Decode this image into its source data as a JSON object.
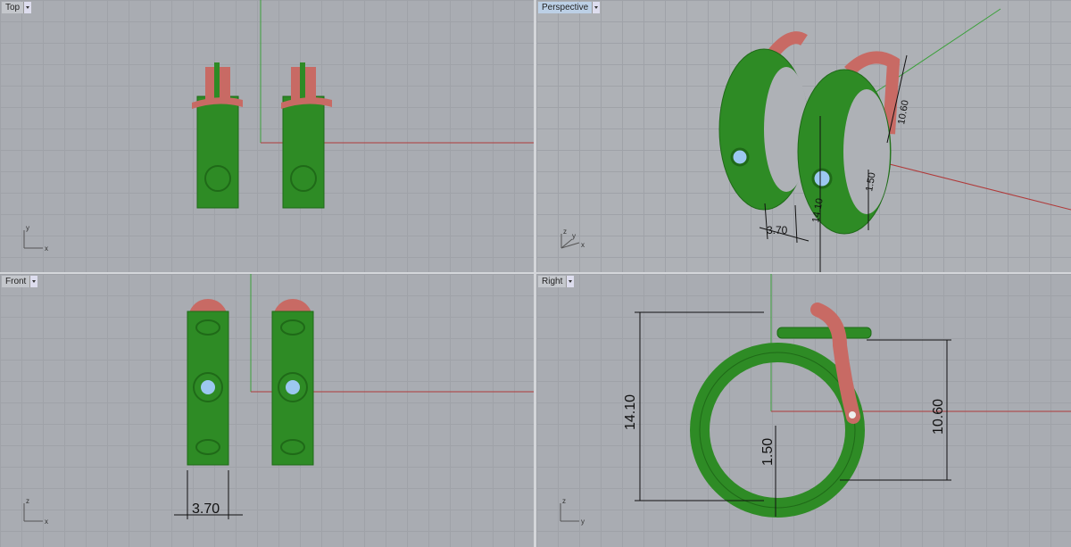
{
  "viewports": [
    {
      "label": "Top",
      "active": false,
      "axes": [
        "x",
        "y"
      ]
    },
    {
      "label": "Perspective",
      "active": true,
      "axes": [
        "x",
        "y",
        "z"
      ],
      "dimensions": [
        "3.70",
        "14.10",
        "10.60",
        "1.50"
      ]
    },
    {
      "label": "Front",
      "active": false,
      "axes": [
        "x",
        "z"
      ],
      "dimensions": [
        "3.70"
      ]
    },
    {
      "label": "Right",
      "active": false,
      "axes": [
        "y",
        "z"
      ],
      "dimensions": [
        "14.10",
        "10.60",
        "1.50"
      ]
    }
  ],
  "colors": {
    "body": "#2e8b25",
    "clasp": "#c86a64",
    "gem": "#9cc8f0",
    "x_axis": "#b03a3a",
    "y_axis": "#3aa03a",
    "background": "#a9acb2"
  }
}
